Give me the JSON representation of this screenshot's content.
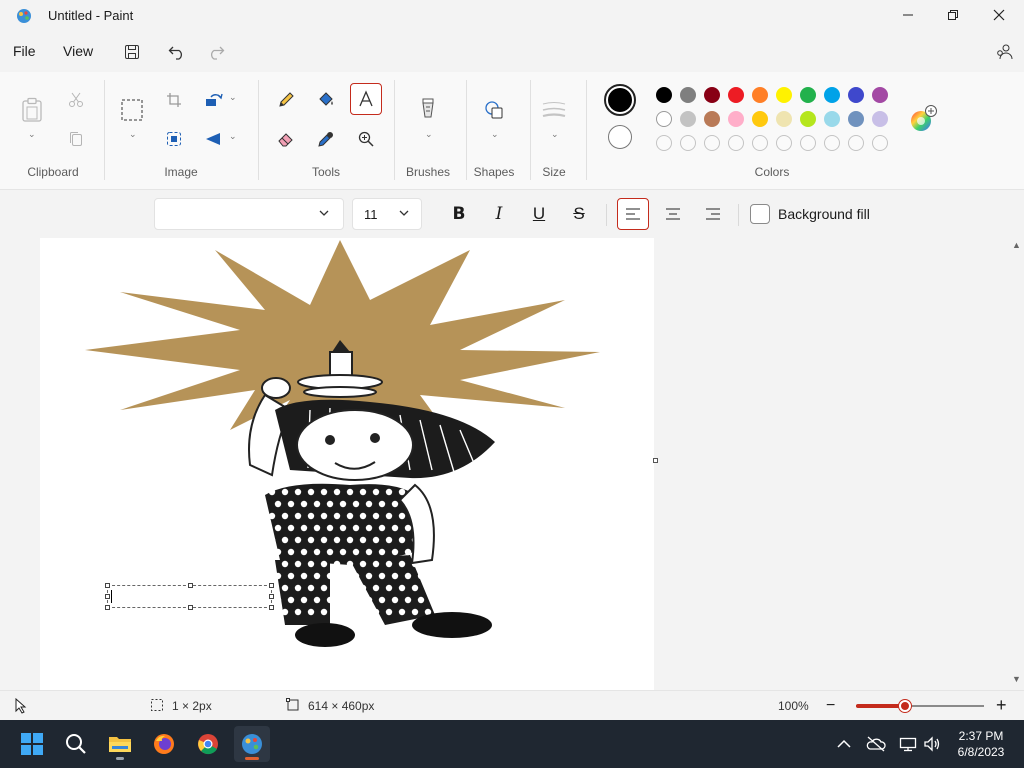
{
  "window": {
    "title": "Untitled - Paint",
    "icon": "paint-app-icon",
    "controls": [
      "minimize-icon",
      "restore-icon",
      "close-icon"
    ]
  },
  "menu": {
    "file": "File",
    "view": "View",
    "icons": [
      "save-icon",
      "undo-icon",
      "redo-icon",
      "account-settings-icon"
    ]
  },
  "ribbon": {
    "groups": {
      "clipboard": "Clipboard",
      "image": "Image",
      "tools": "Tools",
      "brushes": "Brushes",
      "shapes": "Shapes",
      "size": "Size",
      "colors": "Colors"
    },
    "selected_tool": "text",
    "primary_color": "#000000",
    "secondary_color": "#ffffff",
    "palette_row1": [
      "#000000",
      "#7f7f7f",
      "#880015",
      "#ed1c24",
      "#ff7f27",
      "#fff200",
      "#22b14c",
      "#00a2e8",
      "#3f48cc",
      "#a349a4"
    ],
    "palette_row2": [
      "#ffffff",
      "#c3c3c3",
      "#b97a57",
      "#ffaec9",
      "#ffc90e",
      "#efe4b0",
      "#b5e61d",
      "#99d9ea",
      "#7092be",
      "#c8bfe7"
    ],
    "palette_row3_empty_count": 10
  },
  "text_toolbar": {
    "font_value": "",
    "font_size": "11",
    "bold": "B",
    "italic": "I",
    "underline": "U",
    "strikethrough": "S",
    "align_active": "left",
    "background_fill_label": "Background fill",
    "background_fill_checked": false
  },
  "canvas": {
    "image": "cartoon figure holding an object on head in front of a gold starburst"
  },
  "status": {
    "selection_size": "1 × 2px",
    "canvas_size": "614 × 460px",
    "zoom": "100%",
    "zoom_percent_of_track": 0.38
  },
  "taskbar": {
    "apps": [
      "windows-start-icon",
      "search-icon",
      "file-explorer-icon",
      "firefox-icon",
      "chrome-icon",
      "paint-taskbar-icon"
    ],
    "time": "2:37 PM",
    "date": "6/8/2023",
    "accent": "#e06030"
  }
}
